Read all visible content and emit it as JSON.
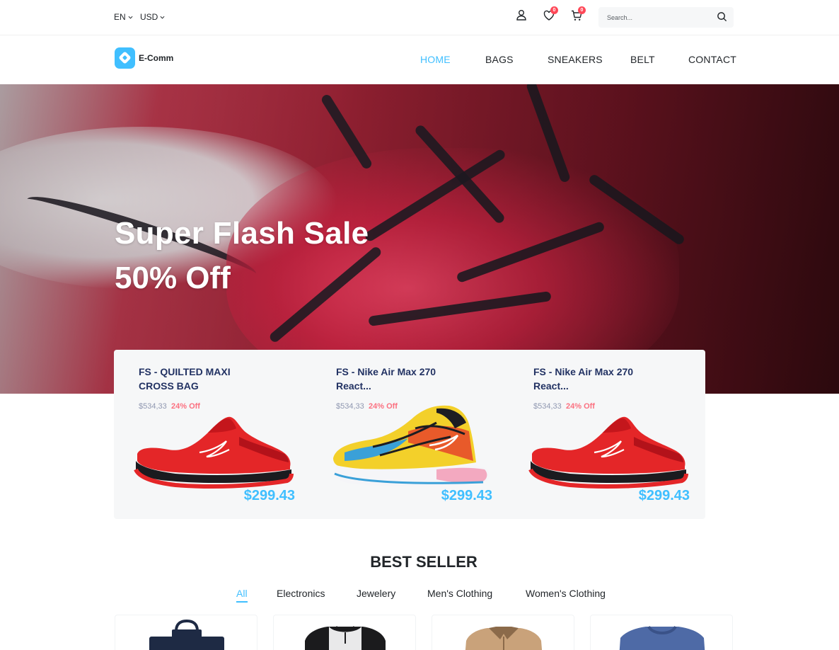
{
  "topbar": {
    "language": "EN",
    "currency": "USD",
    "wishlist_count": "0",
    "cart_count": "0",
    "search_placeholder": "Search..."
  },
  "brand": {
    "name": "E-Comm",
    "accent": "#40bfff"
  },
  "nav": {
    "links": [
      {
        "label": "HOME",
        "active": true
      },
      {
        "label": "BAGS",
        "active": false
      },
      {
        "label": "SNEAKERS",
        "active": false
      },
      {
        "label": "BELT",
        "active": false
      },
      {
        "label": "CONTACT",
        "active": false
      }
    ]
  },
  "hero": {
    "title": "Super Flash Sale",
    "subtitle": "50% Off"
  },
  "flash_products": [
    {
      "name": "FS - QUILTED MAXI CROSS BAG",
      "old_price": "$534,33",
      "discount": "24% Off",
      "price": "$299.43",
      "image": "red-sneaker"
    },
    {
      "name": "FS - Nike Air Max 270 React...",
      "old_price": "$534,33",
      "discount": "24% Off",
      "price": "$299.43",
      "image": "colorful-sneaker"
    },
    {
      "name": "FS - Nike Air Max 270 React...",
      "old_price": "$534,33",
      "discount": "24% Off",
      "price": "$299.43",
      "image": "red-sneaker"
    }
  ],
  "best_seller": {
    "title": "BEST SELLER",
    "tabs": [
      {
        "label": "All",
        "active": true
      },
      {
        "label": "Electronics",
        "active": false
      },
      {
        "label": "Jewelery",
        "active": false
      },
      {
        "label": "Men's Clothing",
        "active": false
      },
      {
        "label": "Women's Clothing",
        "active": false
      }
    ],
    "products": [
      {
        "image": "navy-backpack"
      },
      {
        "image": "raglan-tshirt"
      },
      {
        "image": "tan-jacket"
      },
      {
        "image": "blue-tshirt"
      }
    ]
  },
  "colors": {
    "accent": "#40bfff",
    "badge": "#ff4858",
    "discount": "#fb7181",
    "product_name": "#223263",
    "muted": "#9098b1"
  }
}
